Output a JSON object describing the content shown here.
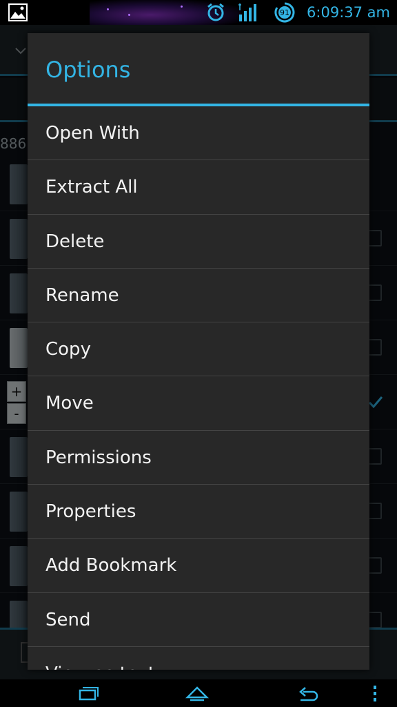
{
  "status_bar": {
    "time": "6:09:37 am",
    "battery_level": "91",
    "accent_color": "#33b5e5"
  },
  "background": {
    "path_fragment": "886"
  },
  "dialog": {
    "title": "Options",
    "items": [
      {
        "label": "Open With"
      },
      {
        "label": "Extract All"
      },
      {
        "label": "Delete"
      },
      {
        "label": "Rename"
      },
      {
        "label": "Copy"
      },
      {
        "label": "Move"
      },
      {
        "label": "Permissions"
      },
      {
        "label": "Properties"
      },
      {
        "label": "Add Bookmark"
      },
      {
        "label": "Send"
      },
      {
        "label": "View as text"
      }
    ]
  },
  "nav_bar": {
    "icons": [
      "recent-apps-icon",
      "home-icon",
      "back-icon",
      "overflow-menu-icon"
    ]
  }
}
